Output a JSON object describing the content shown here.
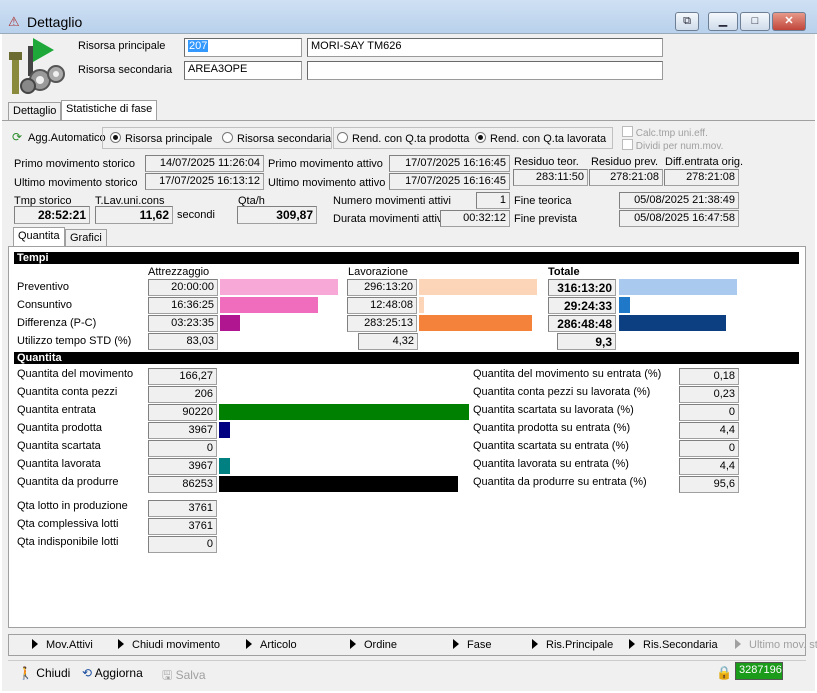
{
  "window": {
    "title": "Dettaglio",
    "restore_btn": "⧉",
    "min_btn": "▁",
    "max_btn": "□",
    "close_btn": "✕"
  },
  "header": {
    "risorsa_principale_label": "Risorsa principale",
    "risorsa_principale_code": "207",
    "risorsa_principale_desc": "MORI-SAY TM626",
    "risorsa_secondaria_label": "Risorsa secondaria",
    "risorsa_secondaria_code": "AREA3OPE",
    "risorsa_secondaria_desc": ""
  },
  "tabs": [
    "Dettaglio",
    "Statistiche di fase"
  ],
  "options": {
    "agg_automatico": "Agg.Automatico",
    "radio1": [
      "Risorsa principale",
      "Risorsa secondaria"
    ],
    "radio2": [
      "Rend. con Q.ta prodotta",
      "Rend. con Q.ta lavorata"
    ],
    "calc_tmp": "Calc.tmp uni.eff.",
    "dividi": "Dividi per num.mov."
  },
  "info": {
    "primo_storico_label": "Primo movimento storico",
    "primo_storico": "14/07/2025 11:26:04",
    "ultimo_storico_label": "Ultimo movimento storico",
    "ultimo_storico": "17/07/2025 16:13:12",
    "primo_attivo_label": "Primo movimento attivo",
    "primo_attivo": "17/07/2025 16:16:45",
    "ultimo_attivo_label": "Ultimo movimento attivo",
    "ultimo_attivo": "17/07/2025 16:16:45",
    "residuo_teor_label": "Residuo teor.",
    "residuo_teor": "283:11:50",
    "residuo_prev_label": "Residuo prev.",
    "residuo_prev": "278:21:08",
    "diff_entrata_label": "Diff.entrata orig.",
    "diff_entrata": "278:21:08",
    "tmp_storico_label": "Tmp storico",
    "tmp_storico": "28:52:21",
    "tlav_label": "T.Lav.uni.cons",
    "tlav": "11,62",
    "secondi": "secondi",
    "qtah_label": "Qta/h",
    "qtah": "309,87",
    "num_mov_label": "Numero movimenti attivi",
    "num_mov": "1",
    "durata_label": "Durata movimenti attivi",
    "durata": "00:32:12",
    "fine_teorica_label": "Fine teorica",
    "fine_teorica": "05/08/2025 21:38:49",
    "fine_prevista_label": "Fine prevista",
    "fine_prevista": "05/08/2025 16:47:58"
  },
  "subtabs": [
    "Quantita",
    "Grafici"
  ],
  "tempi": {
    "band": "Tempi",
    "col_attr": "Attrezzaggio",
    "col_lav": "Lavorazione",
    "col_tot": "Totale",
    "rows": [
      {
        "label": "Preventivo",
        "attr": "20:00:00",
        "lav": "296:13:20",
        "tot": "316:13:20"
      },
      {
        "label": "Consuntivo",
        "attr": "16:36:25",
        "lav": "12:48:08",
        "tot": "29:24:33"
      },
      {
        "label": "Differenza (P-C)",
        "attr": "03:23:35",
        "lav": "283:25:13",
        "tot": "286:48:48"
      },
      {
        "label": "Utilizzo tempo STD (%)",
        "attr": "83,03",
        "lav": "4,32",
        "tot": "9,3"
      }
    ],
    "bars": {
      "attr": [
        1.0,
        0.83,
        0.17
      ],
      "lav": [
        1.0,
        0.04,
        0.96
      ],
      "tot": [
        1.0,
        0.09,
        0.91
      ]
    },
    "colors": {
      "attr": [
        "#f7a8d6",
        "#f06cbd",
        "#b0168f"
      ],
      "lav": [
        "#fcd4b8",
        "#fcd4b8",
        "#f5823a"
      ],
      "tot": [
        "#a9c9ee",
        "#1f78c8",
        "#0c3f82"
      ]
    }
  },
  "quantita": {
    "band": "Quantita",
    "left": [
      {
        "label": "Quantita del movimento",
        "value": "166,27"
      },
      {
        "label": "Quantita conta pezzi",
        "value": "206"
      },
      {
        "label": "Quantita entrata",
        "value": "90220"
      },
      {
        "label": "Quantita prodotta",
        "value": "3967"
      },
      {
        "label": "Quantita scartata",
        "value": "0"
      },
      {
        "label": "Quantita lavorata",
        "value": "3967"
      },
      {
        "label": "Quantita da produrre",
        "value": "86253"
      }
    ],
    "bars": [
      0,
      0,
      1.0,
      0.044,
      0,
      0.044,
      0.956
    ],
    "bar_colors": [
      "#000000",
      "#000000",
      "#008000",
      "#000080",
      "#000000",
      "#008080",
      "#000000"
    ],
    "right": [
      {
        "label": "Quantita del movimento su entrata (%)",
        "value": "0,18"
      },
      {
        "label": "Quantita conta pezzi su lavorata (%)",
        "value": "0,23"
      },
      {
        "label": "Quantita scartata su lavorata (%)",
        "value": "0"
      },
      {
        "label": "Quantita prodotta su entrata (%)",
        "value": "4,4"
      },
      {
        "label": "Quantita scartata su entrata (%)",
        "value": "0"
      },
      {
        "label": "Quantita lavorata su entrata (%)",
        "value": "4,4"
      },
      {
        "label": "Quantita da produrre su entrata (%)",
        "value": "95,6"
      }
    ],
    "lotti": [
      {
        "label": "Qta lotto in produzione",
        "value": "3761"
      },
      {
        "label": "Qta complessiva lotti",
        "value": "3761"
      },
      {
        "label": "Qta indisponibile lotti",
        "value": "0"
      }
    ]
  },
  "nav": [
    "Mov.Attivi",
    "Chiudi movimento",
    "Articolo",
    "Ordine",
    "Fase",
    "Ris.Principale",
    "Ris.Secondaria",
    "Ultimo mov. sto"
  ],
  "status": {
    "chiudi": "Chiudi",
    "aggiorna": "Aggiorna",
    "salva": "Salva",
    "code": "3287196"
  }
}
